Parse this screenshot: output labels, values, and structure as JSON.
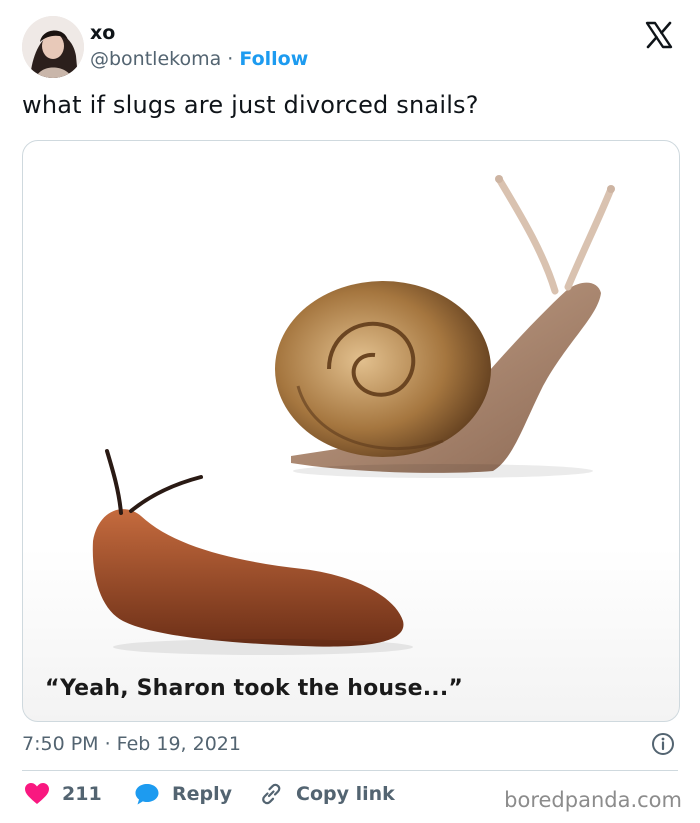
{
  "author": {
    "name": "xo",
    "handle": "@bontlekoma",
    "separator": "·",
    "follow_label": "Follow"
  },
  "tweet": {
    "text": "what if slugs are just divorced snails?",
    "media_caption": "“Yeah, Sharon took the house...”",
    "timestamp": "7:50 PM · Feb 19, 2021"
  },
  "actions": {
    "like_count": "211",
    "reply_label": "Reply",
    "copy_label": "Copy link"
  },
  "icons": {
    "x_logo": "x-logo-icon",
    "info": "info-icon",
    "heart": "heart-icon",
    "reply": "speech-bubble-icon",
    "link": "link-icon"
  },
  "colors": {
    "accent": "#1d9bf0",
    "like": "#f91880",
    "muted": "#536471"
  },
  "watermark": "boredpanda.com"
}
